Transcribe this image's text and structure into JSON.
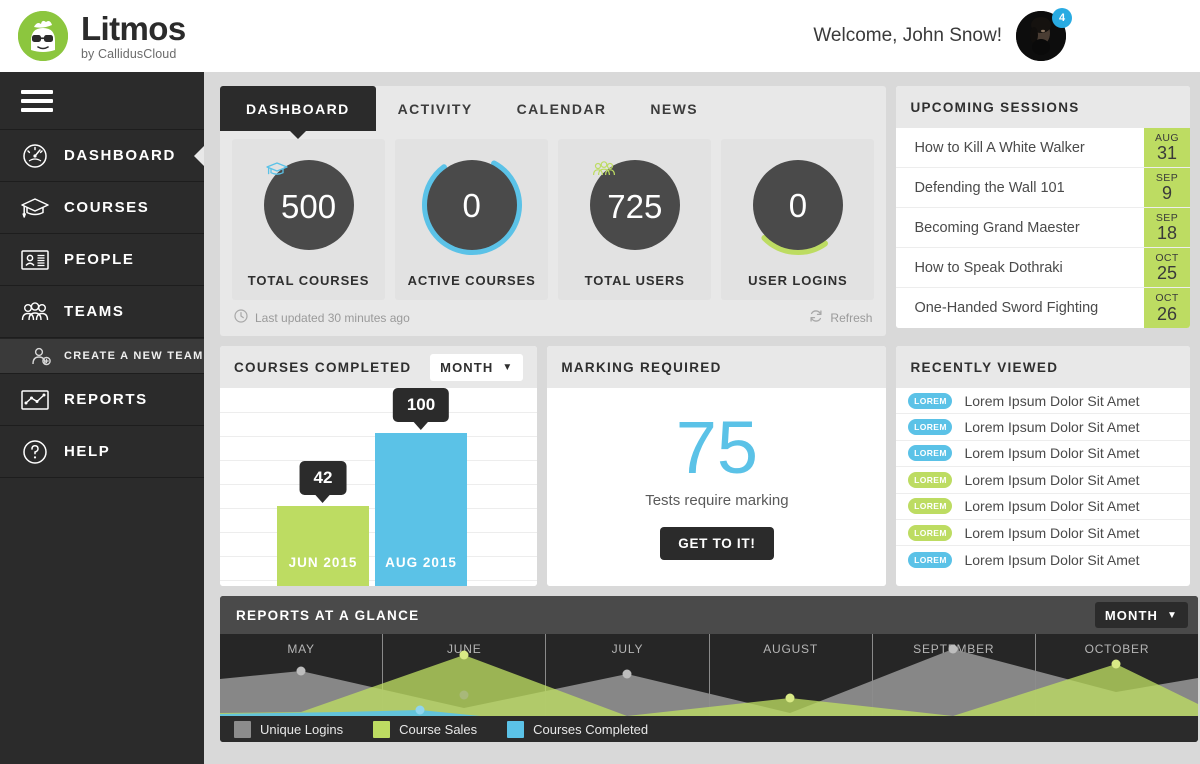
{
  "brand": {
    "name": "Litmos",
    "tagline": "by CallidusCloud",
    "logo_icon": "litmos-face-logo",
    "green": "#8CC63E"
  },
  "header": {
    "welcome": "Welcome, John Snow!",
    "avatar_icon": "user-avatar",
    "notification_count": "4",
    "badge_color": "#29ABE2"
  },
  "sidebar": {
    "menu_icon": "hamburger-menu-icon",
    "items": [
      {
        "label": "DASHBOARD",
        "icon": "speedometer-icon",
        "active": true,
        "sub": false
      },
      {
        "label": "COURSES",
        "icon": "graduation-cap-icon",
        "active": false,
        "sub": false
      },
      {
        "label": "PEOPLE",
        "icon": "id-card-icon",
        "active": false,
        "sub": false
      },
      {
        "label": "TEAMS",
        "icon": "people-group-icon",
        "active": false,
        "sub": false
      },
      {
        "label": "CREATE A NEW TEAM",
        "icon": "add-person-icon",
        "active": false,
        "sub": true
      },
      {
        "label": "REPORTS",
        "icon": "line-chart-icon",
        "active": false,
        "sub": false
      },
      {
        "label": "HELP",
        "icon": "question-circle-icon",
        "active": false,
        "sub": false
      }
    ]
  },
  "tabs": [
    {
      "label": "DASHBOARD",
      "active": true
    },
    {
      "label": "ACTIVITY",
      "active": false
    },
    {
      "label": "CALENDAR",
      "active": false
    },
    {
      "label": "NEWS",
      "active": false
    }
  ],
  "stats": {
    "cards": [
      {
        "value": "500",
        "label": "TOTAL COURSES",
        "icon": "graduation-cap-icon",
        "ring_pct": 0,
        "ring_color": "#5BC2E7"
      },
      {
        "value": "0",
        "label": "ACTIVE COURSES",
        "icon": "none",
        "ring_pct": 82,
        "ring_color": "#5BC2E7"
      },
      {
        "value": "725",
        "label": "TOTAL USERS",
        "icon": "people-group-icon",
        "ring_pct": 0,
        "ring_color": "#BDDC62"
      },
      {
        "value": "0",
        "label": "USER LOGINS",
        "icon": "none",
        "ring_pct": 22,
        "ring_color": "#BDDC62"
      }
    ],
    "last_updated": "Last updated 30 minutes ago",
    "last_updated_icon": "clock-icon",
    "refresh_label": "Refresh",
    "refresh_icon": "refresh-icon"
  },
  "upcoming_sessions": {
    "title": "UPCOMING SESSIONS",
    "rows": [
      {
        "name": "How to Kill A White Walker",
        "month": "AUG",
        "day": "31"
      },
      {
        "name": "Defending the Wall 101",
        "month": "SEP",
        "day": "9"
      },
      {
        "name": "Becoming Grand Maester",
        "month": "SEP",
        "day": "18"
      },
      {
        "name": "How to Speak Dothraki",
        "month": "OCT",
        "day": "25"
      },
      {
        "name": "One-Handed Sword Fighting",
        "month": "OCT",
        "day": "26"
      }
    ]
  },
  "courses_completed": {
    "title": "COURSES COMPLETED",
    "range_label": "MONTH",
    "chevron_icon": "chevron-down-icon"
  },
  "marking_required": {
    "title": "MARKING REQUIRED",
    "count": "75",
    "subtitle": "Tests require marking",
    "button_label": "GET TO IT!"
  },
  "recently_viewed": {
    "title": "RECENTLY VIEWED",
    "rows": [
      {
        "badge": "LOREM",
        "text": "Lorem Ipsum Dolor Sit Amet",
        "color": "#5BC2E7"
      },
      {
        "badge": "LOREM",
        "text": "Lorem Ipsum Dolor Sit Amet",
        "color": "#5BC2E7"
      },
      {
        "badge": "LOREM",
        "text": "Lorem Ipsum Dolor Sit Amet",
        "color": "#5BC2E7"
      },
      {
        "badge": "LOREM",
        "text": "Lorem Ipsum Dolor Sit Amet",
        "color": "#BDDC62"
      },
      {
        "badge": "LOREM",
        "text": "Lorem Ipsum Dolor Sit Amet",
        "color": "#BDDC62"
      },
      {
        "badge": "LOREM",
        "text": "Lorem Ipsum Dolor Sit Amet",
        "color": "#BDDC62"
      },
      {
        "badge": "LOREM",
        "text": "Lorem Ipsum Dolor Sit Amet",
        "color": "#5BC2E7"
      }
    ]
  },
  "reports": {
    "title": "REPORTS AT A GLANCE",
    "range_label": "MONTH",
    "chevron_icon": "chevron-down-icon"
  },
  "chart_data": [
    {
      "type": "bar",
      "title": "COURSES COMPLETED",
      "categories": [
        "JUN 2015",
        "AUG 2015"
      ],
      "values": [
        42,
        100
      ],
      "labels": [
        "42",
        "100"
      ],
      "colors": [
        "#BDDC62",
        "#5BC2E7"
      ],
      "ylim": [
        0,
        125
      ],
      "grid": true,
      "xlabel": "",
      "ylabel": ""
    },
    {
      "type": "area",
      "title": "REPORTS AT A GLANCE",
      "categories": [
        "MAY",
        "JUNE",
        "JULY",
        "AUGUST",
        "SEPTEMBER",
        "OCTOBER"
      ],
      "series": [
        {
          "name": "Unique Logins",
          "color": "#8c8c8c",
          "values": [
            55,
            10,
            48,
            4,
            72,
            30
          ]
        },
        {
          "name": "Course Sales",
          "color": "#BDDC62",
          "values": [
            4,
            75,
            1,
            25,
            2,
            62
          ]
        },
        {
          "name": "Courses Completed",
          "color": "#5BC2E7",
          "values": [
            8,
            1,
            0,
            0,
            0,
            0
          ]
        }
      ],
      "legend_position": "bottom",
      "ylim": [
        0,
        100
      ],
      "grid": false,
      "xlabel": "",
      "ylabel": ""
    }
  ]
}
